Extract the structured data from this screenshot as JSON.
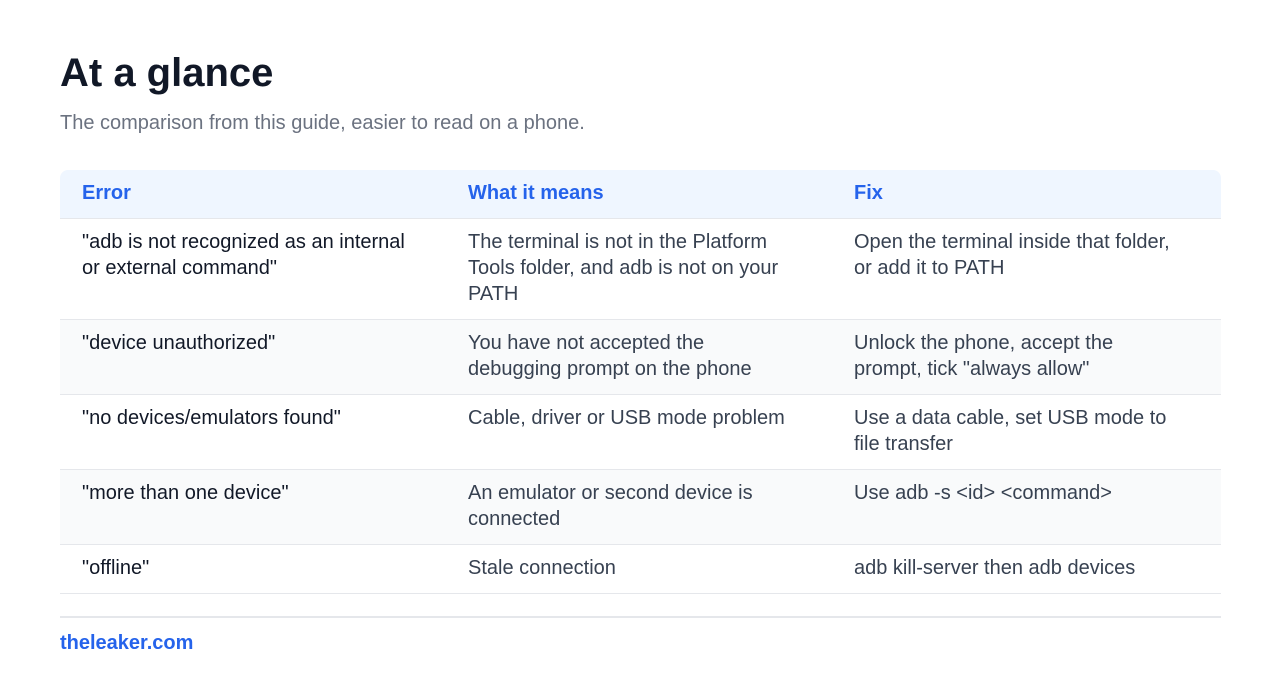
{
  "header": {
    "title": "At a glance",
    "subtitle": "The comparison from this guide, easier to read on a phone."
  },
  "table": {
    "columns": [
      "Error",
      "What it means",
      "Fix"
    ],
    "rows": [
      {
        "error": "\"adb is not recognized as an internal or external command\"",
        "meaning": "The terminal is not in the Platform Tools folder, and adb is not on your PATH",
        "fix": "Open the terminal inside that folder, or add it to PATH"
      },
      {
        "error": "\"device unauthorized\"",
        "meaning": "You have not accepted the debugging prompt on the phone",
        "fix": "Unlock the phone, accept the prompt, tick \"always allow\""
      },
      {
        "error": "\"no devices/emulators found\"",
        "meaning": "Cable, driver or USB mode problem",
        "fix": "Use a data cable, set USB mode to file transfer"
      },
      {
        "error": "\"more than one device\"",
        "meaning": "An emulator or second device is connected",
        "fix": "Use adb -s <id> <command>"
      },
      {
        "error": "\"offline\"",
        "meaning": "Stale connection",
        "fix": "adb kill-server then adb devices"
      }
    ]
  },
  "footer": {
    "site": "theleaker.com"
  },
  "colors": {
    "accent": "#2563eb",
    "header_bg": "#eff6ff",
    "alt_row_bg": "#f9fafb",
    "border": "#e5e7eb"
  }
}
